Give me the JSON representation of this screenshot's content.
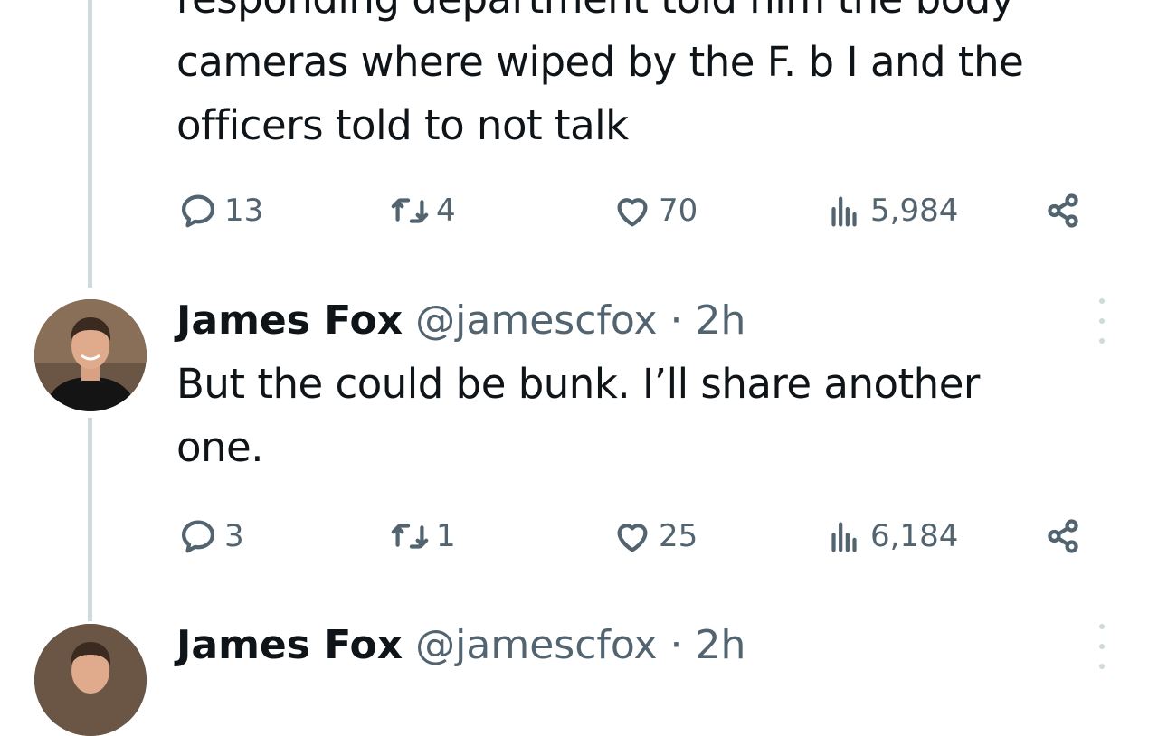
{
  "tweets": [
    {
      "text": "responding department told him the body\ncameras where wiped by the F. b I and the\nofficers told to not talk",
      "stats": {
        "replies": "13",
        "reposts": "4",
        "likes": "70",
        "views": "5,984"
      }
    },
    {
      "author": {
        "name": "James Fox",
        "handle": "@jamescfox",
        "separator": "·",
        "time": "2h"
      },
      "text": "But the could be bunk. I’ll share another\none.",
      "stats": {
        "replies": "3",
        "reposts": "1",
        "likes": "25",
        "views": "6,184"
      }
    },
    {
      "author": {
        "name": "James Fox",
        "handle": "@jamescfox",
        "separator": "·",
        "time": "2h"
      }
    }
  ],
  "icons": {
    "reply": "reply-icon",
    "repost": "repost-icon",
    "like": "heart-icon",
    "views": "views-icon",
    "share": "share-icon",
    "more": "more-vertical-icon"
  },
  "colors": {
    "text": "#0f1419",
    "secondary": "#536471",
    "thread_line": "#cfd9de"
  }
}
